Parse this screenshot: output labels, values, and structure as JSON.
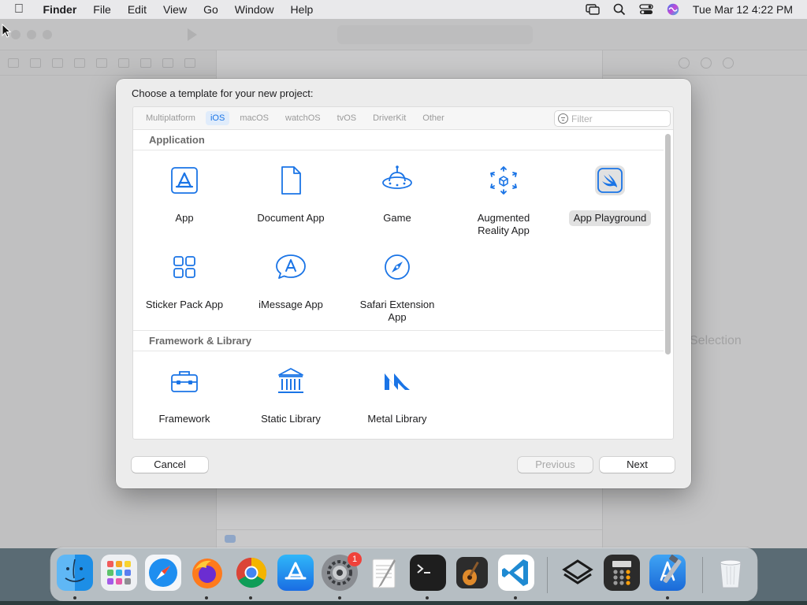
{
  "menubar": {
    "app_name": "Finder",
    "items": [
      "File",
      "Edit",
      "View",
      "Go",
      "Window",
      "Help"
    ],
    "clock": "Tue Mar 12  4:22 PM",
    "status_icons": [
      "screen-mirroring-icon",
      "spotlight-search-icon",
      "control-center-icon",
      "siri-icon"
    ]
  },
  "background_window": {
    "editor_placeholder": "Selection"
  },
  "dialog": {
    "title": "Choose a template for your new project:",
    "tabs": [
      "Multiplatform",
      "iOS",
      "macOS",
      "watchOS",
      "tvOS",
      "DriverKit",
      "Other"
    ],
    "selected_tab": "iOS",
    "filter_placeholder": "Filter",
    "sections": [
      {
        "title": "Application",
        "items": [
          {
            "label": "App",
            "icon": "app-store-a-icon"
          },
          {
            "label": "Document App",
            "icon": "document-icon"
          },
          {
            "label": "Game",
            "icon": "game-ufo-icon"
          },
          {
            "label": "Augmented Reality App",
            "icon": "ar-cube-icon"
          },
          {
            "label": "App Playground",
            "icon": "swift-icon",
            "selected": true
          },
          {
            "label": "Sticker Pack App",
            "icon": "sticker-grid-icon"
          },
          {
            "label": "iMessage App",
            "icon": "imessage-icon"
          },
          {
            "label": "Safari Extension App",
            "icon": "safari-compass-icon"
          }
        ]
      },
      {
        "title": "Framework & Library",
        "items": [
          {
            "label": "Framework",
            "icon": "toolbox-icon"
          },
          {
            "label": "Static Library",
            "icon": "library-columns-icon"
          },
          {
            "label": "Metal Library",
            "icon": "metal-icon"
          }
        ]
      }
    ],
    "buttons": {
      "cancel": "Cancel",
      "previous": "Previous",
      "next": "Next"
    },
    "accent_color": "#1a74e6"
  },
  "dock": {
    "apps": [
      "Finder",
      "Launchpad",
      "Safari",
      "Firefox",
      "Chrome",
      "App Store",
      "System Settings",
      "TextEdit",
      "Terminal",
      "GarageBand",
      "Visual Studio Code",
      "Sketchbook",
      "Calculator",
      "Xcode",
      "Trash"
    ],
    "badge": "1"
  }
}
